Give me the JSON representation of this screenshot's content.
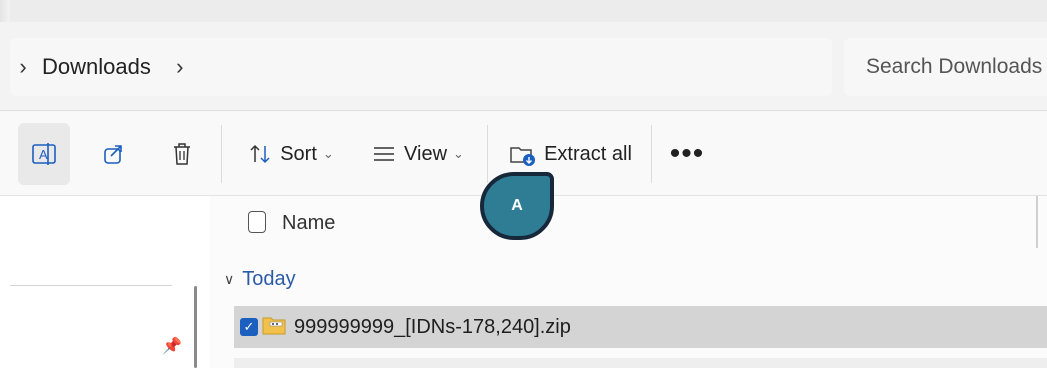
{
  "breadcrumb": {
    "items": [
      "Downloads"
    ]
  },
  "search": {
    "placeholder": "Search Downloads"
  },
  "toolbar": {
    "sort_label": "Sort",
    "view_label": "View",
    "extract_label": "Extract all",
    "more_label": "•••"
  },
  "file_list": {
    "column_name": "Name",
    "group_label": "Today",
    "rows": [
      {
        "name": "999999999_[IDNs-178,240].zip",
        "selected": true
      }
    ]
  },
  "annotation": {
    "label": "A"
  },
  "colors": {
    "accent": "#1b5fbf",
    "marker_fill": "#2e7d95",
    "marker_border": "#16283a",
    "group_text": "#2b5aa6"
  }
}
